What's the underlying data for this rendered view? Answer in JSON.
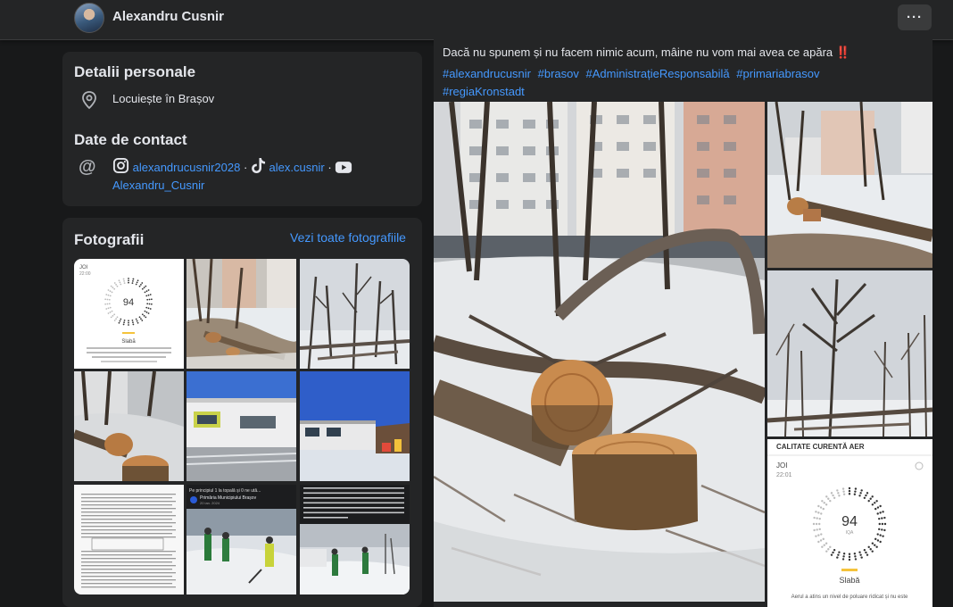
{
  "profile": {
    "name": "Alexandru Cusnir",
    "more_label": "···"
  },
  "details": {
    "title": "Detalii personale",
    "lives_in": "Locuiește în Brașov",
    "contact_title": "Date de contact",
    "instagram": "alexandrucusnir2028",
    "tiktok": "alex.cusnir",
    "youtube": "Alexandru_Cusnir",
    "separator": "·"
  },
  "photos": {
    "title": "Fotografii",
    "see_all": "Vezi toate fotografiile",
    "thumb_aq": {
      "day": "JOI",
      "time": "22:00",
      "value": "94",
      "status": "Slabă",
      "text": "Aerul a atins un nivel de poluare ridicat și nu este sănătos pentru grupurile de persoane sensibile. Reduceți timpul petrecut afară dacă simțiți dificultăți în..."
    },
    "thumb_post": {
      "header": "Pe principiul 1 la topală și 0 ne ută...",
      "page": "Primăria Municipiului Brașov",
      "date": "20 ian. 2024",
      "text": "nine și zăpada e la tăbătorit bine ba chiar a și înghețat peste noapte la -12 grade, voi acuzând oamenii că dau zăpada de pe trotuare? Vorba cuiva: să lucreze de tot banii. Avea în timp ce Colibian stă la căldură și se uită pe geamul de la Primărie cum se face deszăpezirea în oraș.",
      "more": "Ilgendial"
    }
  },
  "post": {
    "text": "Dacă nu spunem și nu facem nimic acum, mâine nu vom mai avea ce apăra",
    "emoji": "‼️",
    "hashtags": [
      "#alexandrucusnir",
      "#brasov",
      "#AdministrațieResponsabilă",
      "#primariabrasov",
      "#regiaKronstadt"
    ],
    "aq_card": {
      "title": "CALITATE CURENTĂ AER",
      "day": "JOI",
      "time": "22:01",
      "value": "94",
      "unit": "IQA",
      "status": "Slabă",
      "text": "Aerul a atins un nivel de poluare ridicat și nu este"
    }
  },
  "colors": {
    "link": "#4599ff",
    "background": "#18191a",
    "card": "#242526",
    "status_bar": "#f5c33b"
  }
}
